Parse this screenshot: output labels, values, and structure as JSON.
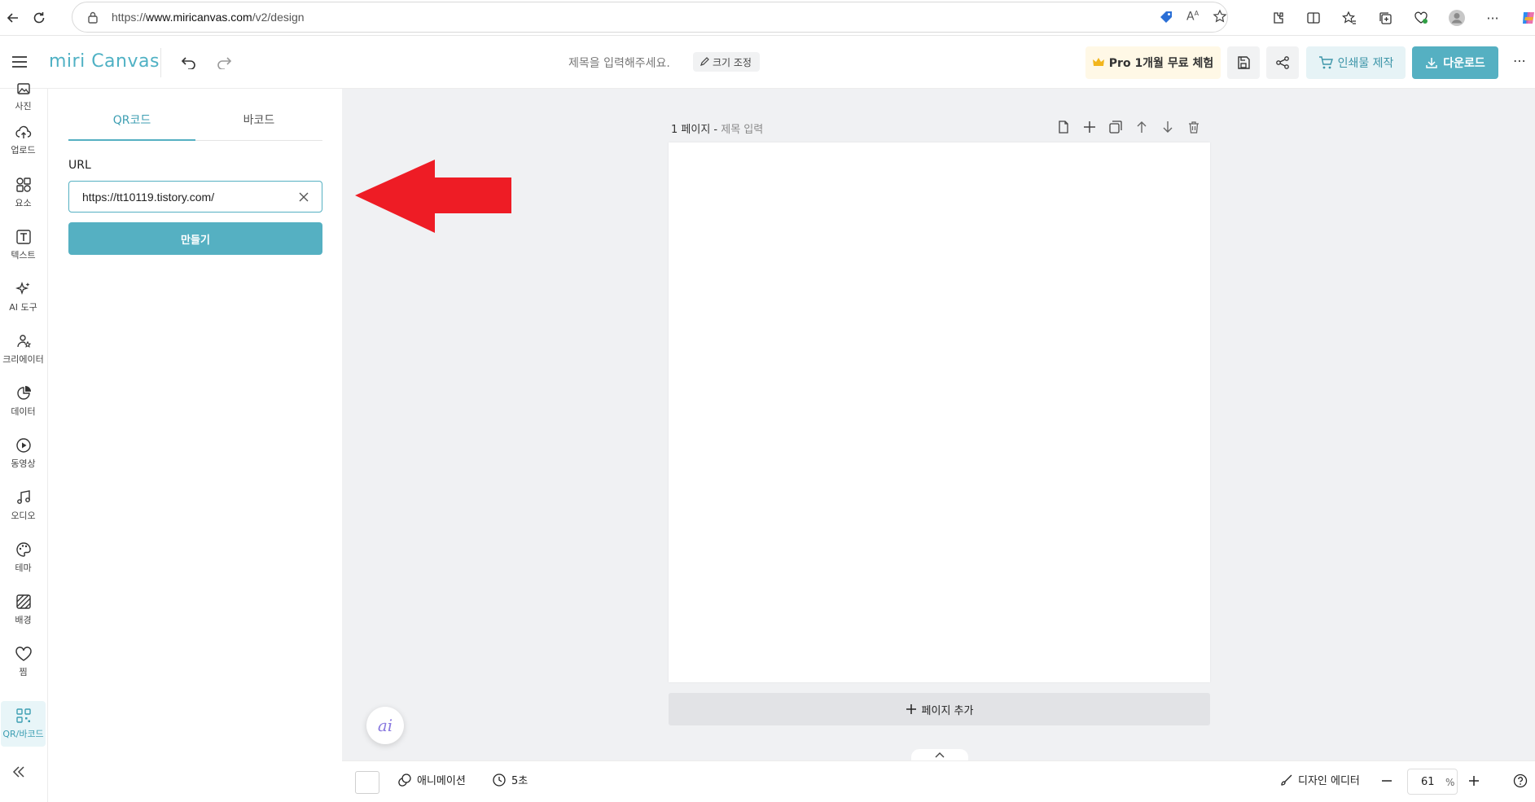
{
  "browser": {
    "url_prefix": "https://",
    "url_domain": "www.miricanvas.com",
    "url_path": "/v2/design"
  },
  "header": {
    "logo": "miri Canvas",
    "title_placeholder": "제목을 입력해주세요.",
    "resize_label": "크기 조정",
    "pro_label": "Pro 1개월 무료 체험",
    "print_label": "인쇄물 제작",
    "download_label": "다운로드"
  },
  "rail": {
    "items": [
      {
        "label": "사진",
        "icon": "photo-icon"
      },
      {
        "label": "업로드",
        "icon": "upload-icon"
      },
      {
        "label": "요소",
        "icon": "elements-icon"
      },
      {
        "label": "텍스트",
        "icon": "text-icon"
      },
      {
        "label": "AI 도구",
        "icon": "ai-sparkle-icon"
      },
      {
        "label": "크리에이터",
        "icon": "creator-icon"
      },
      {
        "label": "데이터",
        "icon": "chart-icon"
      },
      {
        "label": "동영상",
        "icon": "play-icon"
      },
      {
        "label": "오디오",
        "icon": "music-icon"
      },
      {
        "label": "테마",
        "icon": "palette-icon"
      },
      {
        "label": "배경",
        "icon": "background-icon"
      },
      {
        "label": "찜",
        "icon": "heart-icon"
      },
      {
        "label": "QR/바코드",
        "icon": "qr-icon"
      }
    ],
    "active": "QR/바코드"
  },
  "panel": {
    "tabs": [
      "QR코드",
      "바코드"
    ],
    "active_tab": "QR코드",
    "url_label": "URL",
    "url_value": "https://tt10119.tistory.com/",
    "create_label": "만들기"
  },
  "canvas": {
    "page_number_label": "1 페이지 -",
    "page_title_placeholder": "제목 입력",
    "add_page_label": "페이지 추가",
    "ai_label": "ai"
  },
  "bottom": {
    "animation_label": "애니메이션",
    "duration_label": "5초",
    "design_editor_label": "디자인 에디터",
    "zoom_value": "61",
    "zoom_unit": "%"
  },
  "colors": {
    "accent": "#55b0c2",
    "arrow": "#ee1c25",
    "pro_bg": "#fff8e6"
  }
}
